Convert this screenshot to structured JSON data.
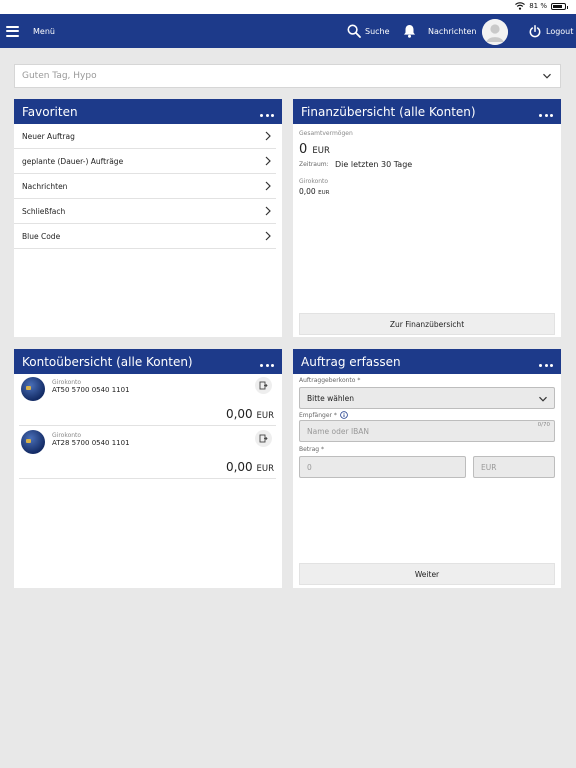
{
  "status": {
    "battery": "81 %",
    "battery_level": 0.81
  },
  "nav": {
    "menu": "Menü",
    "search": "Suche",
    "messages": "Nachrichten",
    "logout": "Logout"
  },
  "greeting": "Guten Tag, Hypo",
  "favorites": {
    "title": "Favoriten",
    "items": [
      "Neuer Auftrag",
      "geplante (Dauer-) Aufträge",
      "Nachrichten",
      "Schließfach",
      "Blue Code"
    ]
  },
  "finance": {
    "title": "Finanzübersicht (alle Konten)",
    "total_label": "Gesamtvermögen",
    "total_value": "0",
    "total_unit": "EUR",
    "period_label": "Zeitraum:",
    "period_value": "Die letzten 30 Tage",
    "account_label": "Girokonto",
    "account_value": "0,00",
    "account_unit": "EUR",
    "button": "Zur Finanzübersicht"
  },
  "accounts": {
    "title": "Kontoübersicht (alle Konten)",
    "items": [
      {
        "type": "Girokonto",
        "iban": "AT50 5700 0540 1101",
        "amount": "0,00",
        "unit": "EUR"
      },
      {
        "type": "Girokonto",
        "iban": "AT28 5700 0540 1101",
        "amount": "0,00",
        "unit": "EUR"
      }
    ]
  },
  "order": {
    "title": "Auftrag erfassen",
    "from_label": "Auftraggeberkonto *",
    "from_value": "Bitte wählen",
    "recipient_label": "Empfänger *",
    "recipient_placeholder": "Name oder IBAN",
    "recipient_counter": "0/70",
    "amount_label": "Betrag *",
    "amount_placeholder": "0",
    "currency_placeholder": "EUR",
    "button": "Weiter"
  },
  "colors": {
    "brand": "#1d3a8a",
    "background": "#e8e8e8"
  }
}
